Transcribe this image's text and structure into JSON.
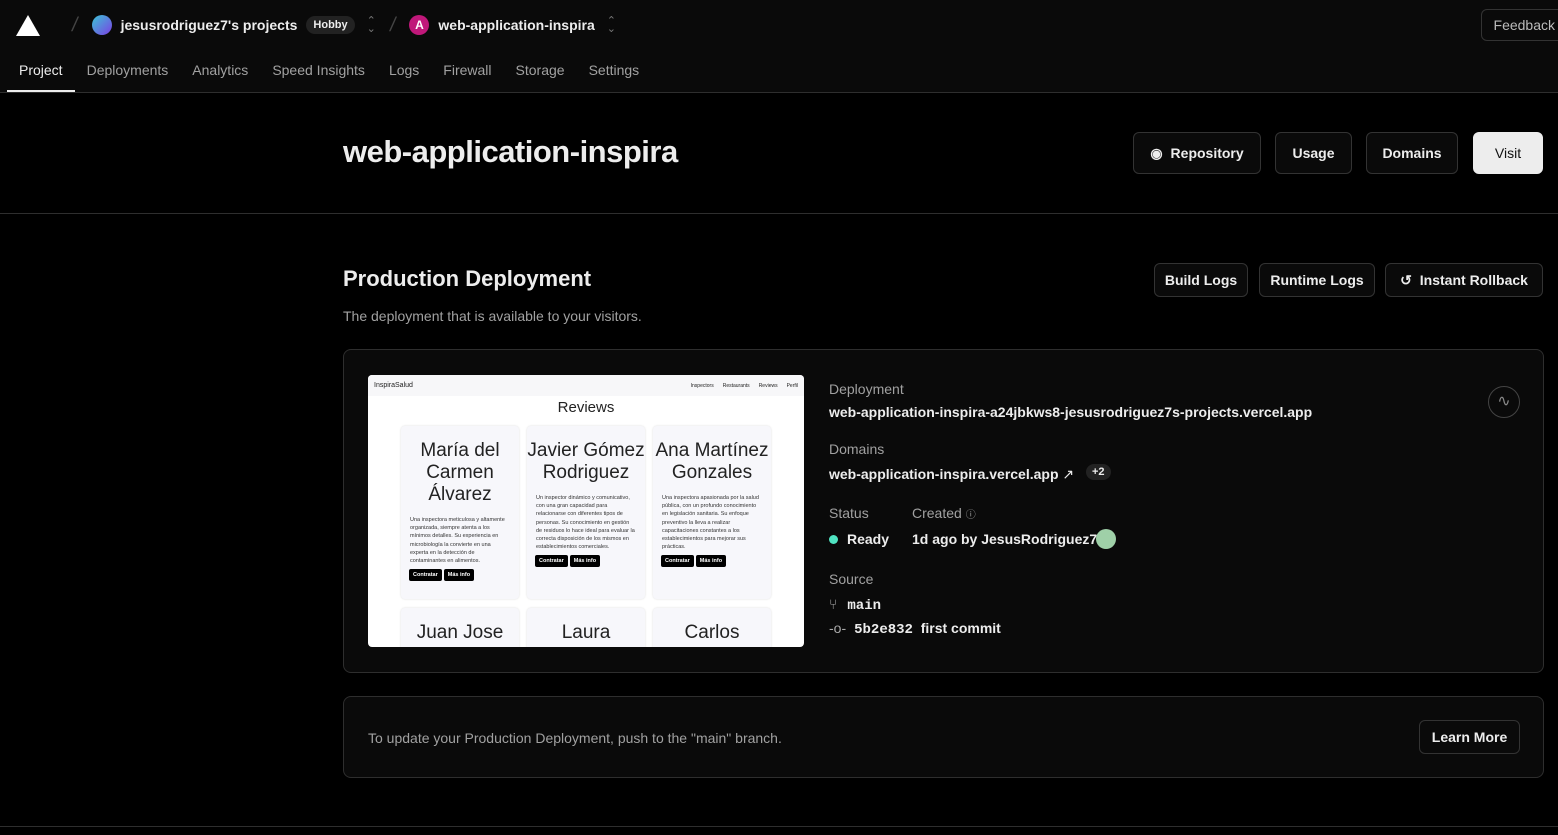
{
  "nav": {
    "team": "jesusrodriguez7's projects",
    "plan": "Hobby",
    "project": "web-application-inspira",
    "feedback": "Feedback",
    "tabs": [
      "Project",
      "Deployments",
      "Analytics",
      "Speed Insights",
      "Logs",
      "Firewall",
      "Storage",
      "Settings"
    ]
  },
  "header": {
    "title": "web-application-inspira",
    "repository": "Repository",
    "usage": "Usage",
    "domains": "Domains",
    "visit": "Visit"
  },
  "production": {
    "title": "Production Deployment",
    "subtitle": "The deployment that is available to your visitors.",
    "build_logs": "Build Logs",
    "runtime_logs": "Runtime Logs",
    "rollback": "Instant Rollback"
  },
  "preview": {
    "brand": "InspiraSalud",
    "links": [
      "Inspectors",
      "Restaurants",
      "Reviews",
      "Perfil"
    ],
    "title": "Reviews",
    "hire": "Contratar",
    "more": "Más info",
    "cards": [
      {
        "name": "María del Carmen Álvarez",
        "desc": "Una inspectora meticulosa y altamente organizada, siempre atenta a los mínimos detalles. Su experiencia en microbiología la convierte en una experta en la detección de contaminantes en alimentos."
      },
      {
        "name": "Javier Gómez Rodriguez",
        "desc": "Un inspector dinámico y comunicativo, con una gran capacidad para relacionarse con diferentes tipos de personas. Su conocimiento en gestión de residuos lo hace ideal para evaluar la correcta disposición de los mismos en establecimientos comerciales."
      },
      {
        "name": "Ana Martínez Gonzales",
        "desc": "Una inspectora apasionada por la salud pública, con un profundo conocimiento en legislación sanitaria. Su enfoque preventivo la lleva a realizar capacitaciones constantes a los establecimientos para mejorar sus prácticas."
      },
      {
        "name": "Juan Jose"
      },
      {
        "name": "Laura"
      },
      {
        "name": "Carlos"
      }
    ]
  },
  "deployment": {
    "label": "Deployment",
    "url": "web-application-inspira-a24jbkws8-jesusrodriguez7s-projects.vercel.app",
    "domains_label": "Domains",
    "domain": "web-application-inspira.vercel.app",
    "domain_extra": "+2",
    "status_label": "Status",
    "status": "Ready",
    "status_color": "#50e3c2",
    "created_label": "Created",
    "created": "1d ago by JesusRodriguez7",
    "source_label": "Source",
    "branch": "main",
    "commit_hash": "5b2e832",
    "commit_msg": "first commit"
  },
  "note": {
    "text": "To update your Production Deployment, push to the \"main\" branch.",
    "learn_more": "Learn More"
  }
}
